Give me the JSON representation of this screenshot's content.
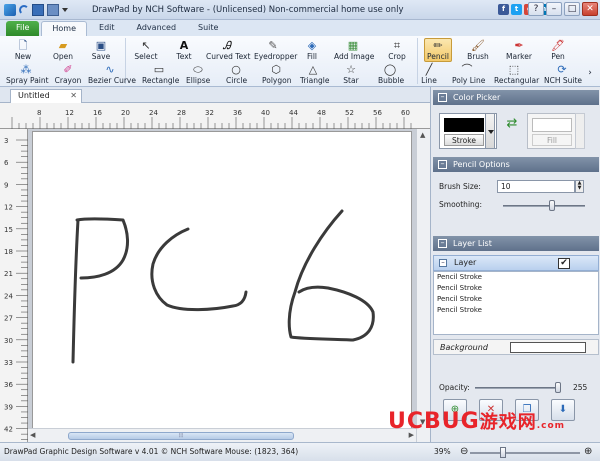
{
  "window": {
    "title": "DrawPad by NCH Software - (Unlicensed) Non-commercial home use only"
  },
  "ribbon_tabs": [
    {
      "label": "File"
    },
    {
      "label": "Home"
    },
    {
      "label": "Edit"
    },
    {
      "label": "Advanced"
    },
    {
      "label": "Suite"
    }
  ],
  "tools_row1": [
    {
      "label": "New",
      "icon": "new-icon"
    },
    {
      "label": "Open",
      "icon": "open-icon"
    },
    {
      "label": "Save",
      "icon": "save-icon"
    },
    {
      "label": "Select",
      "icon": "select-icon"
    },
    {
      "label": "Text",
      "icon": "text-icon"
    },
    {
      "label": "Curved Text",
      "icon": "curved-text-icon"
    },
    {
      "label": "Eyedropper",
      "icon": "eyedropper-icon"
    },
    {
      "label": "Fill",
      "icon": "fill-icon"
    },
    {
      "label": "Add Image",
      "icon": "add-image-icon"
    },
    {
      "label": "Crop",
      "icon": "crop-icon"
    },
    {
      "label": "Pencil",
      "icon": "pencil-icon"
    },
    {
      "label": "Brush",
      "icon": "brush-icon"
    },
    {
      "label": "Marker",
      "icon": "marker-icon"
    },
    {
      "label": "Pen",
      "icon": "pen-icon"
    }
  ],
  "tools_row2": [
    {
      "label": "Spray Paint",
      "icon": "spray-paint-icon"
    },
    {
      "label": "Crayon",
      "icon": "crayon-icon"
    },
    {
      "label": "Bezier Curve",
      "icon": "bezier-curve-icon"
    },
    {
      "label": "Rectangle",
      "icon": "rectangle-icon"
    },
    {
      "label": "Ellipse",
      "icon": "ellipse-icon"
    },
    {
      "label": "Circle",
      "icon": "circle-icon"
    },
    {
      "label": "Polygon",
      "icon": "polygon-icon"
    },
    {
      "label": "Triangle",
      "icon": "triangle-icon"
    },
    {
      "label": "Star",
      "icon": "star-icon"
    },
    {
      "label": "Bubble",
      "icon": "bubble-icon"
    },
    {
      "label": "Line",
      "icon": "line-icon"
    },
    {
      "label": "Poly Line",
      "icon": "poly-line-icon"
    },
    {
      "label": "Rectangular",
      "icon": "rectangular-icon"
    },
    {
      "label": "NCH Suite",
      "icon": "nch-suite-icon"
    }
  ],
  "document": {
    "tab_label": "Untitled"
  },
  "rulers": {
    "top": [
      "8",
      "12",
      "16",
      "20",
      "24",
      "28",
      "32",
      "36",
      "40",
      "44",
      "48",
      "52",
      "56",
      "60"
    ],
    "left": [
      "3",
      "6",
      "9",
      "12",
      "15",
      "18",
      "21",
      "24",
      "27",
      "30",
      "33",
      "36",
      "39",
      "42"
    ]
  },
  "panel": {
    "color_picker_title": "Color Picker",
    "stroke_label": "Stroke",
    "fill_label": "Fill",
    "stroke_color": "#000000",
    "fill_color": "#ffffff",
    "pencil_options_title": "Pencil Options",
    "brush_size_label": "Brush Size:",
    "brush_size_value": "10",
    "smoothing_label": "Smoothing:",
    "smoothing_level": 0.6,
    "layer_list_title": "Layer List",
    "layer_name": "Layer",
    "layer_items": [
      "Pencil Stroke",
      "Pencil Stroke",
      "Pencil Stroke",
      "Pencil Stroke"
    ],
    "background_label": "Background",
    "opacity_label": "Opacity:",
    "opacity_value": "255",
    "opacity_level": 1.0
  },
  "status": {
    "text": "DrawPad Graphic Design Software v 4.01 © NCH Software Mouse: (1823, 364)",
    "zoom": "39%"
  },
  "watermark": {
    "text1": "UCBUG",
    "text2": "游戏网",
    "text3": ".com"
  }
}
